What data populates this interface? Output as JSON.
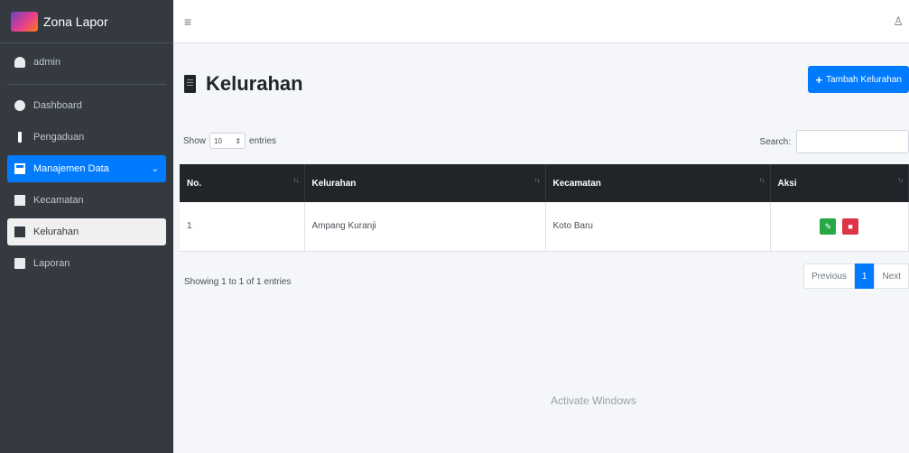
{
  "app": {
    "brand": "Zona Lapor",
    "logo_text": "Zona Lapor"
  },
  "sidebar": {
    "user": "admin",
    "items": [
      {
        "label": "Dashboard",
        "icon": "dashboard-icon"
      },
      {
        "label": "Pengaduan",
        "icon": "exclamation-icon"
      },
      {
        "label": "Manajemen Data",
        "icon": "table-icon",
        "chevron": "⌄"
      },
      {
        "label": "Kecamatan",
        "icon": "building-icon"
      },
      {
        "label": "Kelurahan",
        "icon": "building-icon"
      },
      {
        "label": "Laporan",
        "icon": "file-icon"
      }
    ]
  },
  "topbar": {
    "menu_icon": "≡",
    "user_icon": "♙"
  },
  "page": {
    "title": "Kelurahan",
    "add_button": "Tambah Kelurahan",
    "show_label": "Show",
    "entries_label": "entries",
    "entries_value": "10",
    "search_label": "Search:",
    "table": {
      "headers": [
        "No.",
        "Kelurahan",
        "Kecamatan",
        "Aksi"
      ],
      "rows": [
        {
          "no": "1",
          "kelurahan": "Ampang Kuranji",
          "kecamatan": "Koto Baru"
        }
      ]
    },
    "info": "Showing 1 to 1 of 1 entries",
    "pager": {
      "prev": "Previous",
      "current": "1",
      "next": "Next"
    }
  },
  "watermark": "Activate Windows",
  "colors": {
    "sidebar": "#343a40",
    "primary": "#007bff",
    "edit": "#28a745",
    "delete": "#dc3545"
  }
}
